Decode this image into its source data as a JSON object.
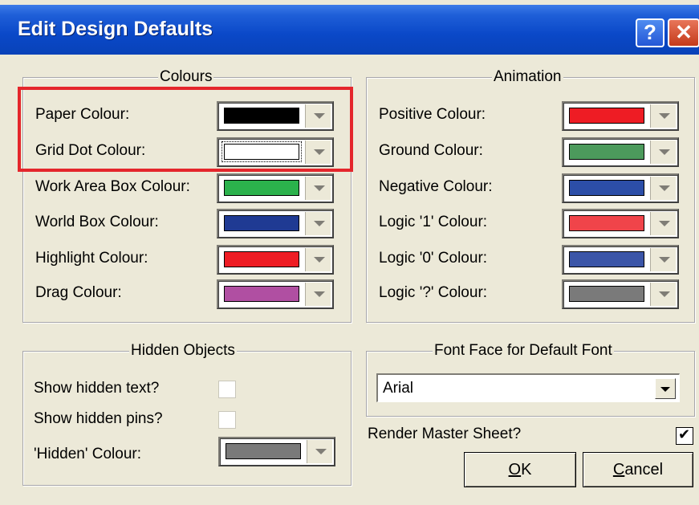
{
  "window": {
    "title": "Edit Design Defaults",
    "help_label": "?",
    "close_label": "✕"
  },
  "colours": {
    "legend": "Colours",
    "items": [
      {
        "label": "Paper Colour:",
        "color": "#000000"
      },
      {
        "label": "Grid Dot Colour:",
        "color": "#ffffff",
        "focused": true
      },
      {
        "label": "Work Area Box Colour:",
        "color": "#2bb24c"
      },
      {
        "label": "World Box Colour:",
        "color": "#1f3a93"
      },
      {
        "label": "Highlight Colour:",
        "color": "#ee1c24"
      },
      {
        "label": "Drag Colour:",
        "color": "#b04fa2"
      }
    ]
  },
  "animation": {
    "legend": "Animation",
    "items": [
      {
        "label": "Positive Colour:",
        "color": "#ee1c24"
      },
      {
        "label": "Ground Colour:",
        "color": "#4c9a5c"
      },
      {
        "label": "Negative Colour:",
        "color": "#2c4ea8"
      },
      {
        "label": "Logic '1' Colour:",
        "color": "#f0444a"
      },
      {
        "label": "Logic '0' Colour:",
        "color": "#3b55a8"
      },
      {
        "label": "Logic '?' Colour:",
        "color": "#7a7a7a"
      }
    ]
  },
  "hidden": {
    "legend": "Hidden Objects",
    "show_text_label": "Show hidden text?",
    "show_text_checked": false,
    "show_pins_label": "Show hidden pins?",
    "show_pins_checked": false,
    "colour_label": "'Hidden' Colour:",
    "colour": "#7a7a7a"
  },
  "font": {
    "legend": "Font Face for Default Font",
    "value": "Arial"
  },
  "render_master": {
    "label": "Render Master Sheet?",
    "checked": true
  },
  "buttons": {
    "ok_accel": "O",
    "ok_rest": "K",
    "cancel_accel": "C",
    "cancel_rest": "ancel"
  },
  "annotation_color": "#e4262c"
}
